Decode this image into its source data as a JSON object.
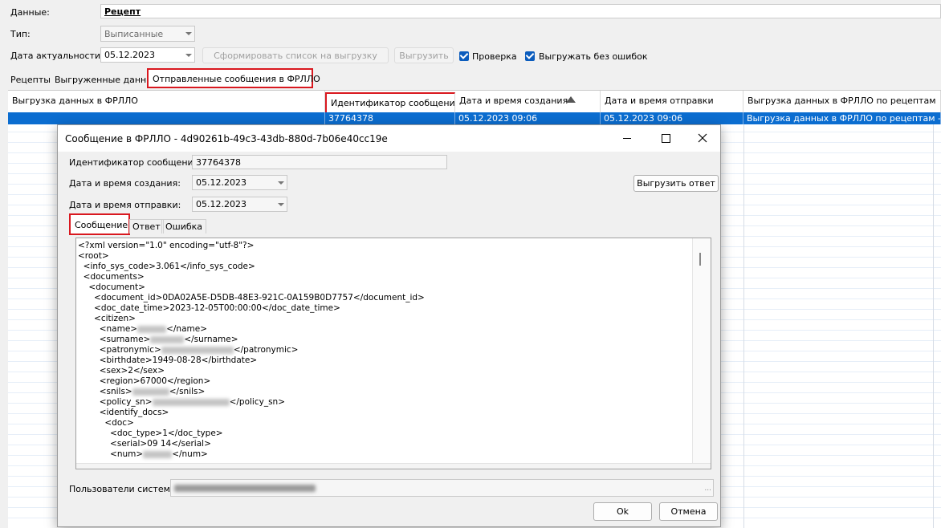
{
  "top": {
    "data_label": "Данные:",
    "data_value": "Рецепт",
    "type_label": "Тип:",
    "type_value": "Выписанные",
    "date_label": "Дата актуальности:",
    "date_value": "05.12.2023",
    "form_button": "Сформировать список на выгрузку",
    "upload_button": "Выгрузить",
    "check_label": "Проверка",
    "upload_no_errors_label": "Выгружать без ошибок"
  },
  "tabs": [
    "Рецепты",
    "Выгруженные данные",
    "Отправленные сообщения в ФРЛЛО"
  ],
  "grid": {
    "headers": [
      "Выгрузка данных в ФРЛЛО",
      "Идентификатор сообщения...",
      "Дата и время создания",
      "Дата и время отправки",
      "Выгрузка данных в ФРЛЛО по рецептам"
    ],
    "row": [
      "",
      "37764378",
      "05.12.2023 09:06",
      "05.12.2023 09:06",
      "Выгрузка данных в ФРЛЛО по рецептам - ..."
    ]
  },
  "dialog": {
    "title": "Сообщение в ФРЛЛО - 4d90261b-49c3-43db-880d-7b06e40cc19e",
    "id_label": "Идентификатор сообщения:",
    "id_value": "37764378",
    "created_label": "Дата и время создания:",
    "created_value": "05.12.2023",
    "sent_label": "Дата и время отправки:",
    "sent_value": "05.12.2023",
    "export_answer_button": "Выгрузить ответ",
    "tabs": [
      "Сообщение",
      "Ответ",
      "Ошибка"
    ],
    "xml_lines": [
      "<?xml version=\"1.0\" encoding=\"utf-8\"?>",
      "<root>",
      "  <info_sys_code>3.061</info_sys_code>",
      "  <documents>",
      "    <document>",
      "      <document_id>0DA02A5E-D5DB-48E3-921C-0A159B0D7757</document_id>",
      "      <doc_date_time>2023-12-05T00:00:00</doc_date_time>",
      "      <citizen>",
      "        <name>",
      "        <surname>",
      "        <patronymic>",
      "        <birthdate>1949-08-28</birthdate>",
      "        <sex>2</sex>",
      "        <region>67000</region>",
      "        <snils>",
      "        <policy_sn>",
      "        <identify_docs>",
      "          <doc>",
      "            <doc_type>1</doc_type>",
      "            <serial>09 14</serial>",
      "            <num>"
    ],
    "xml_tails": [
      "",
      "",
      "",
      "",
      "",
      "",
      "",
      "",
      "</name>",
      "</surname>",
      "</patronymic>",
      "",
      "",
      "",
      "</snils>",
      "</policy_sn>",
      "",
      "",
      "",
      "",
      "</num>"
    ],
    "users_label": "Пользователи системы:",
    "users_more": "...",
    "ok_button": "Ok",
    "cancel_button": "Отмена"
  },
  "colors": {
    "accent": "#0b6dd0",
    "highlight": "#d9181f"
  }
}
